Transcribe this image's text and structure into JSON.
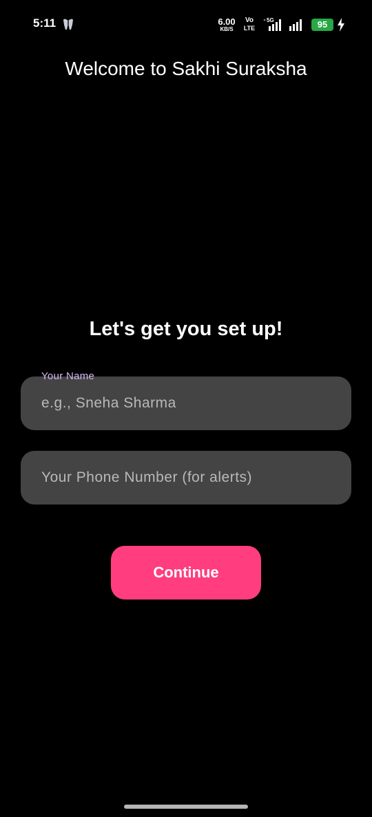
{
  "status_bar": {
    "time": "5:11",
    "net_speed_value": "6.00",
    "net_speed_unit": "KB/S",
    "volte_top": "Vo",
    "volte_bottom": "LTE",
    "network_tag": "5G",
    "battery_level": "95",
    "battery_color": "#27a745",
    "icons": [
      "tooth-icon",
      "signal-bars-icon",
      "charging-bolt-icon"
    ]
  },
  "header": {
    "title": "Welcome to Sakhi Suraksha"
  },
  "setup": {
    "heading": "Let's get you set up!",
    "name_label": "Your Name",
    "name_placeholder": "e.g., Sneha Sharma",
    "name_value": "",
    "phone_placeholder": "Your Phone Number (for alerts)",
    "phone_value": "",
    "continue_label": "Continue"
  },
  "colors": {
    "background": "#000000",
    "field_background": "#444444",
    "accent": "#ff3d7f",
    "label_color": "#d4b6f5"
  }
}
